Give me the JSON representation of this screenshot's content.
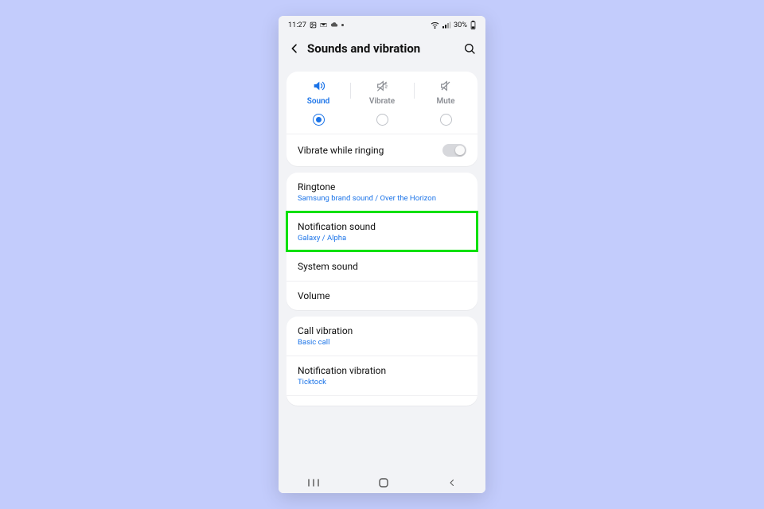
{
  "statusbar": {
    "time": "11:27",
    "battery": "30%",
    "icons": [
      "image",
      "mail",
      "cloud",
      "dot",
      "wifi",
      "signal",
      "battery"
    ]
  },
  "header": {
    "title": "Sounds and vibration"
  },
  "modes": [
    "Sound",
    "Vibrate",
    "Mute"
  ],
  "active_mode_index": 0,
  "vibrate_while_ringing": {
    "label": "Vibrate while ringing",
    "on": false
  },
  "group_sounds": [
    {
      "title": "Ringtone",
      "sub": "Samsung brand sound / Over the Horizon"
    },
    {
      "title": "Notification sound",
      "sub": "Galaxy / Alpha",
      "highlight": true
    },
    {
      "title": "System sound"
    },
    {
      "title": "Volume"
    }
  ],
  "group_vibration": [
    {
      "title": "Call vibration",
      "sub": "Basic call"
    },
    {
      "title": "Notification vibration",
      "sub": "Ticktock"
    }
  ]
}
